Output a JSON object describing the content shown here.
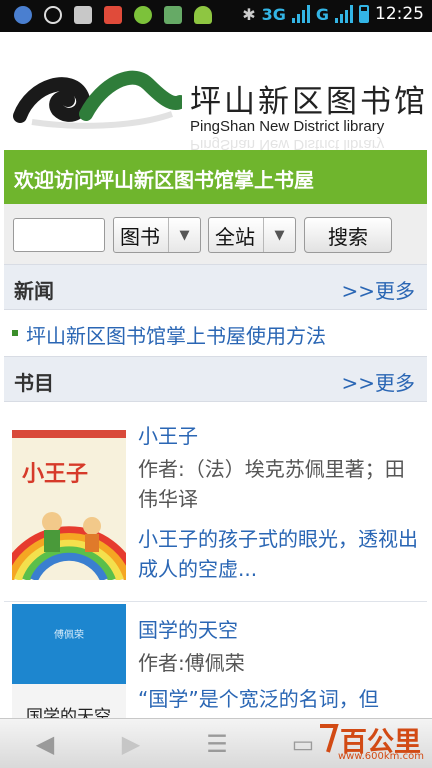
{
  "status_bar": {
    "network": "3G",
    "carrier_signal": "G",
    "time": "12:25",
    "icons": [
      "app-icon",
      "sync-icon",
      "gallery-icon",
      "gmail-icon",
      "wechat-icon",
      "sim-icon",
      "android-icon",
      "bluetooth-icon"
    ]
  },
  "header": {
    "logo_cn": "坪山新区图书馆",
    "logo_en": "PingShan New District library"
  },
  "welcome": {
    "text": "欢迎访问坪山新区图书馆掌上书屋"
  },
  "search": {
    "input_value": "",
    "type_select": "图书",
    "scope_select": "全站",
    "button_label": "搜索"
  },
  "news": {
    "title": "新闻",
    "more": ">>更多",
    "items": [
      {
        "text": "坪山新区图书馆掌上书屋使用方法"
      }
    ]
  },
  "books": {
    "title": "书目",
    "more": ">>更多",
    "items": [
      {
        "title": "小王子",
        "author": "作者:（法）埃克苏佩里著；田伟华译",
        "desc": "小王子的孩子式的眼光，透视出成人的空虚...",
        "cover_text": "小王子"
      },
      {
        "title": "国学的天空",
        "author": "作者:傅佩荣",
        "desc": "“国学”是个宽泛的名词，但",
        "cover_text": "国学的天空",
        "cover_author": "傅佩荣"
      }
    ]
  },
  "watermark": {
    "text": "百公里",
    "url": "www.600km.com"
  },
  "colors": {
    "green_bar": "#6fb52d",
    "link_blue": "#2a66b4",
    "section_bg": "#e9edf3"
  }
}
